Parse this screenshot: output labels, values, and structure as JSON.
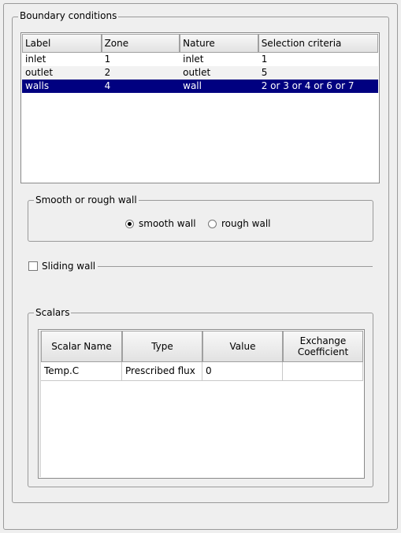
{
  "boundary": {
    "title": "Boundary conditions",
    "columns": [
      "Label",
      "Zone",
      "Nature",
      "Selection criteria"
    ],
    "rows": [
      {
        "label": "inlet",
        "zone": "1",
        "nature": "inlet",
        "criteria": "1"
      },
      {
        "label": "outlet",
        "zone": "2",
        "nature": "outlet",
        "criteria": "5"
      },
      {
        "label": "walls",
        "zone": "4",
        "nature": "wall",
        "criteria": "2 or 3 or 4 or 6 or 7"
      }
    ],
    "selected_row": "walls"
  },
  "wall": {
    "title": "Smooth or rough wall",
    "smooth_label": "smooth wall",
    "rough_label": "rough wall",
    "selected": "smooth wall"
  },
  "sliding": {
    "label": "Sliding wall",
    "checked": false
  },
  "scalars": {
    "title": "Scalars",
    "columns": [
      "Scalar Name",
      "Type",
      "Value",
      "Exchange\nCoefficient"
    ],
    "rows": [
      {
        "name": "Temp.C",
        "type": "Prescribed flux",
        "value": "0",
        "coeff": ""
      }
    ]
  },
  "colors": {
    "selection": "#000080",
    "background": "#efefef"
  }
}
